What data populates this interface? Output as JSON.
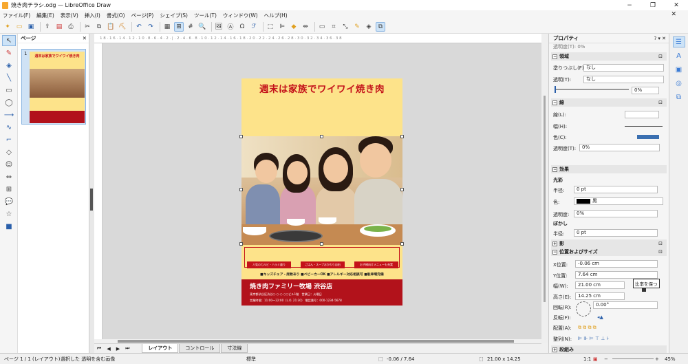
{
  "window": {
    "title": "焼き肉チラシ.odg — LibreOffice Draw",
    "min": "−",
    "max": "❐",
    "close": "✕"
  },
  "menu": [
    "ファイル(F)",
    "編集(E)",
    "表示(V)",
    "挿入(I)",
    "書式(O)",
    "ページ(P)",
    "シェイプ(S)",
    "ツール(T)",
    "ウィンドウ(W)",
    "ヘルプ(H)"
  ],
  "menu_close": "✕",
  "pages_pane": {
    "title": "ページ",
    "close": "✕",
    "page_number": "1"
  },
  "flyer": {
    "title": "週末は家族でワイワイ焼き肉",
    "pills": [
      "人気のカルビ・ハラミ盛り",
      "ごはん・スープおかわり自由",
      "お子様向けメニューも充実"
    ],
    "features": "■キッズチェア・席数あり  ■ベビーカーOK  ■アレルギー対応相談可  ■駐車場完備",
    "store": "焼き肉ファミリー牧場 渋谷店",
    "address": "東京都渋谷区渋谷○-○-○ ○○ビル1階　営業日：火曜日",
    "hours": "営業時間：11:00～22:00（L.O. 21:30） 電話番号：000-1234-5678"
  },
  "ruler": "1 8 · 1 6 · 1 4 · 1 2 · 1 0 · 8 · 6 · 4 · 2 · | · 2 · 4 · 6 · 8 · 1 0 · 1 2 · 1 4 · 1 6 · 1 8 · 2 0 · 2 2 · 2 4 · 2 6 · 2 8 · 3 0 · 3 2 · 3 4 · 3 6 · 3 8",
  "tabs": {
    "layout": "レイアウト",
    "controls": "コントロール",
    "dimensions": "寸法線"
  },
  "status": {
    "page": "ページ 1 / 1 (レイアウト)",
    "selection": "選択した 透明を含む画像",
    "style": "標準",
    "position": "-0.06 / 7.64",
    "size": "21.00 x 14.25",
    "ratio": "1:1",
    "zoom": "45%"
  },
  "properties": {
    "title": "プロパティ",
    "top_row_label": "透明度(T):",
    "top_row_value": "0%",
    "area": {
      "header": "領域",
      "fill_label": "塗りつぶし(F):",
      "fill_value": "なし",
      "transparency_label": "透明(T):",
      "transparency_value": "なし",
      "slider_value": "0%"
    },
    "line": {
      "header": "線",
      "line_label": "線(L):",
      "width_label": "幅(H):",
      "color_label": "色(C):",
      "transparency_label": "透明度(T):",
      "transparency_value": "0%",
      "color": "#3a6fb0"
    },
    "effect": {
      "header": "効果",
      "glow": "光彩",
      "radius_label": "半径:",
      "radius_value": "0 pt",
      "color_label": "色:",
      "color_value": "黒",
      "transp_label": "透明度:",
      "transp_value": "0%",
      "soft": "ぼかし",
      "soft_radius_label": "半径:",
      "soft_radius_value": "0 pt"
    },
    "shadow": {
      "header": "影"
    },
    "pos": {
      "header": "位置およびサイズ",
      "x_label": "X位置:",
      "x_value": "-0.06 cm",
      "y_label": "Y位置:",
      "y_value": "7.64 cm",
      "w_label": "幅(W):",
      "w_value": "21.00 cm",
      "h_label": "高さ(E):",
      "h_value": "14.25 cm",
      "rot_label": "回転(R):",
      "rot_value": "0.00°",
      "flip_label": "反転(F):",
      "arrange_label": "配置(A):",
      "align_label": "整列(N):"
    },
    "para": {
      "header": "段組み"
    },
    "tooltip": "比率を保つ"
  }
}
